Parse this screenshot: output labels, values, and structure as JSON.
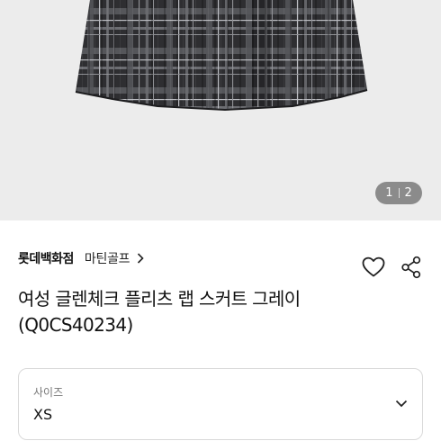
{
  "product": {
    "image_alt": "Plaid pleated wrap skirt",
    "page_indicator": {
      "current": "1",
      "total": "2"
    }
  },
  "seller": {
    "store_name": "롯데백화점",
    "brand_name": "마틴골프"
  },
  "title": "여성 글렌체크 플리츠 랩 스커트 그레이 (Q0CS40234)",
  "option": {
    "label": "사이즈",
    "selected": "XS"
  },
  "icons": {
    "brand_chevron": "chevron-right-icon",
    "wishlist": "heart-icon",
    "share": "share-icon",
    "dropdown": "chevron-down-icon"
  },
  "colors": {
    "image_bg": "#ececec",
    "skirt_dark": "#2b2b2e",
    "border": "#d9d9d9"
  }
}
